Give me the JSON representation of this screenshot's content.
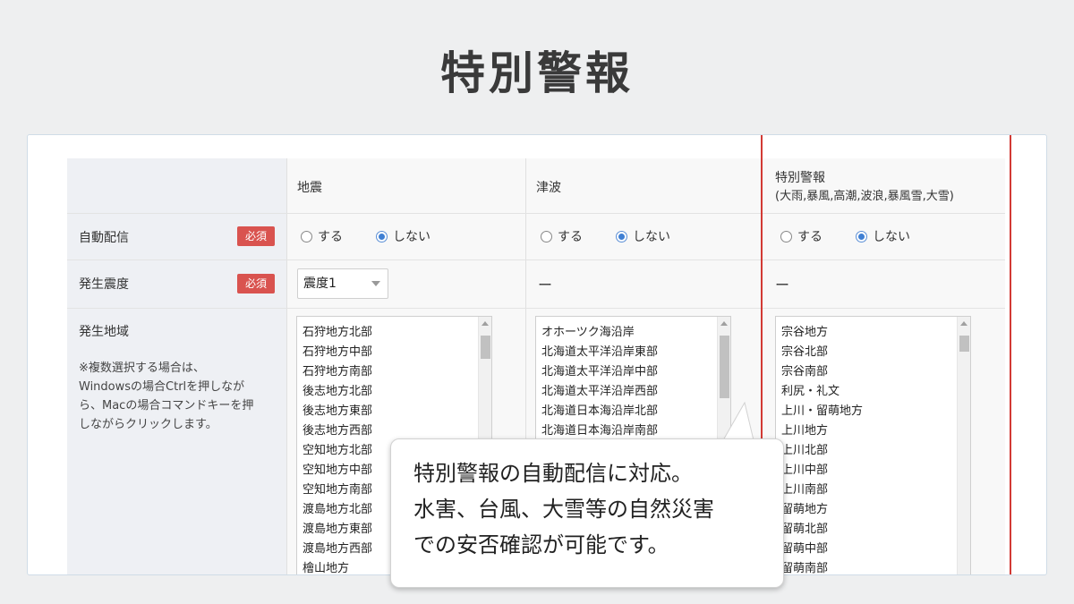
{
  "page_title": "特別警報",
  "columns": {
    "earthquake": "地震",
    "tsunami": "津波",
    "special_line1": "特別警報",
    "special_line2": "(大雨,暴風,高潮,波浪,暴風雪,大雪)"
  },
  "rows": {
    "auto_delivery": "自動配信",
    "intensity": "発生震度",
    "region": "発生地域"
  },
  "required_badge": "必須",
  "radio": {
    "yes": "する",
    "no": "しない",
    "selected": "no"
  },
  "intensity_select": {
    "value": "震度1"
  },
  "dash": "ー",
  "region_note": [
    "※複数選択する場合は、",
    "Windowsの場合Ctrlを押しなが",
    "ら、Macの場合コマンドキーを押",
    "しながらクリックします。"
  ],
  "earthquake_regions": [
    "石狩地方北部",
    "石狩地方中部",
    "石狩地方南部",
    "後志地方北部",
    "後志地方東部",
    "後志地方西部",
    "空知地方北部",
    "空知地方中部",
    "空知地方南部",
    "渡島地方北部",
    "渡島地方東部",
    "渡島地方西部",
    "檜山地方"
  ],
  "tsunami_regions": [
    "オホーツク海沿岸",
    "北海道太平洋沿岸東部",
    "北海道太平洋沿岸中部",
    "北海道太平洋沿岸西部",
    "北海道日本海沿岸北部",
    "北海道日本海沿岸南部"
  ],
  "special_regions": [
    "宗谷地方",
    "宗谷北部",
    "宗谷南部",
    "利尻・礼文",
    "上川・留萌地方",
    "上川地方",
    "上川北部",
    "上川中部",
    "上川南部",
    "留萌地方",
    "留萌北部",
    "留萌中部",
    "留萌南部"
  ],
  "callout": {
    "line1": "特別警報の自動配信に対応。",
    "line2": "水害、台風、大雪等の自然災害",
    "line3": "での安否確認が可能です。"
  },
  "colors": {
    "required": "#d9534f",
    "highlight": "#d23a34",
    "radio_selected": "#3f7fd3"
  }
}
